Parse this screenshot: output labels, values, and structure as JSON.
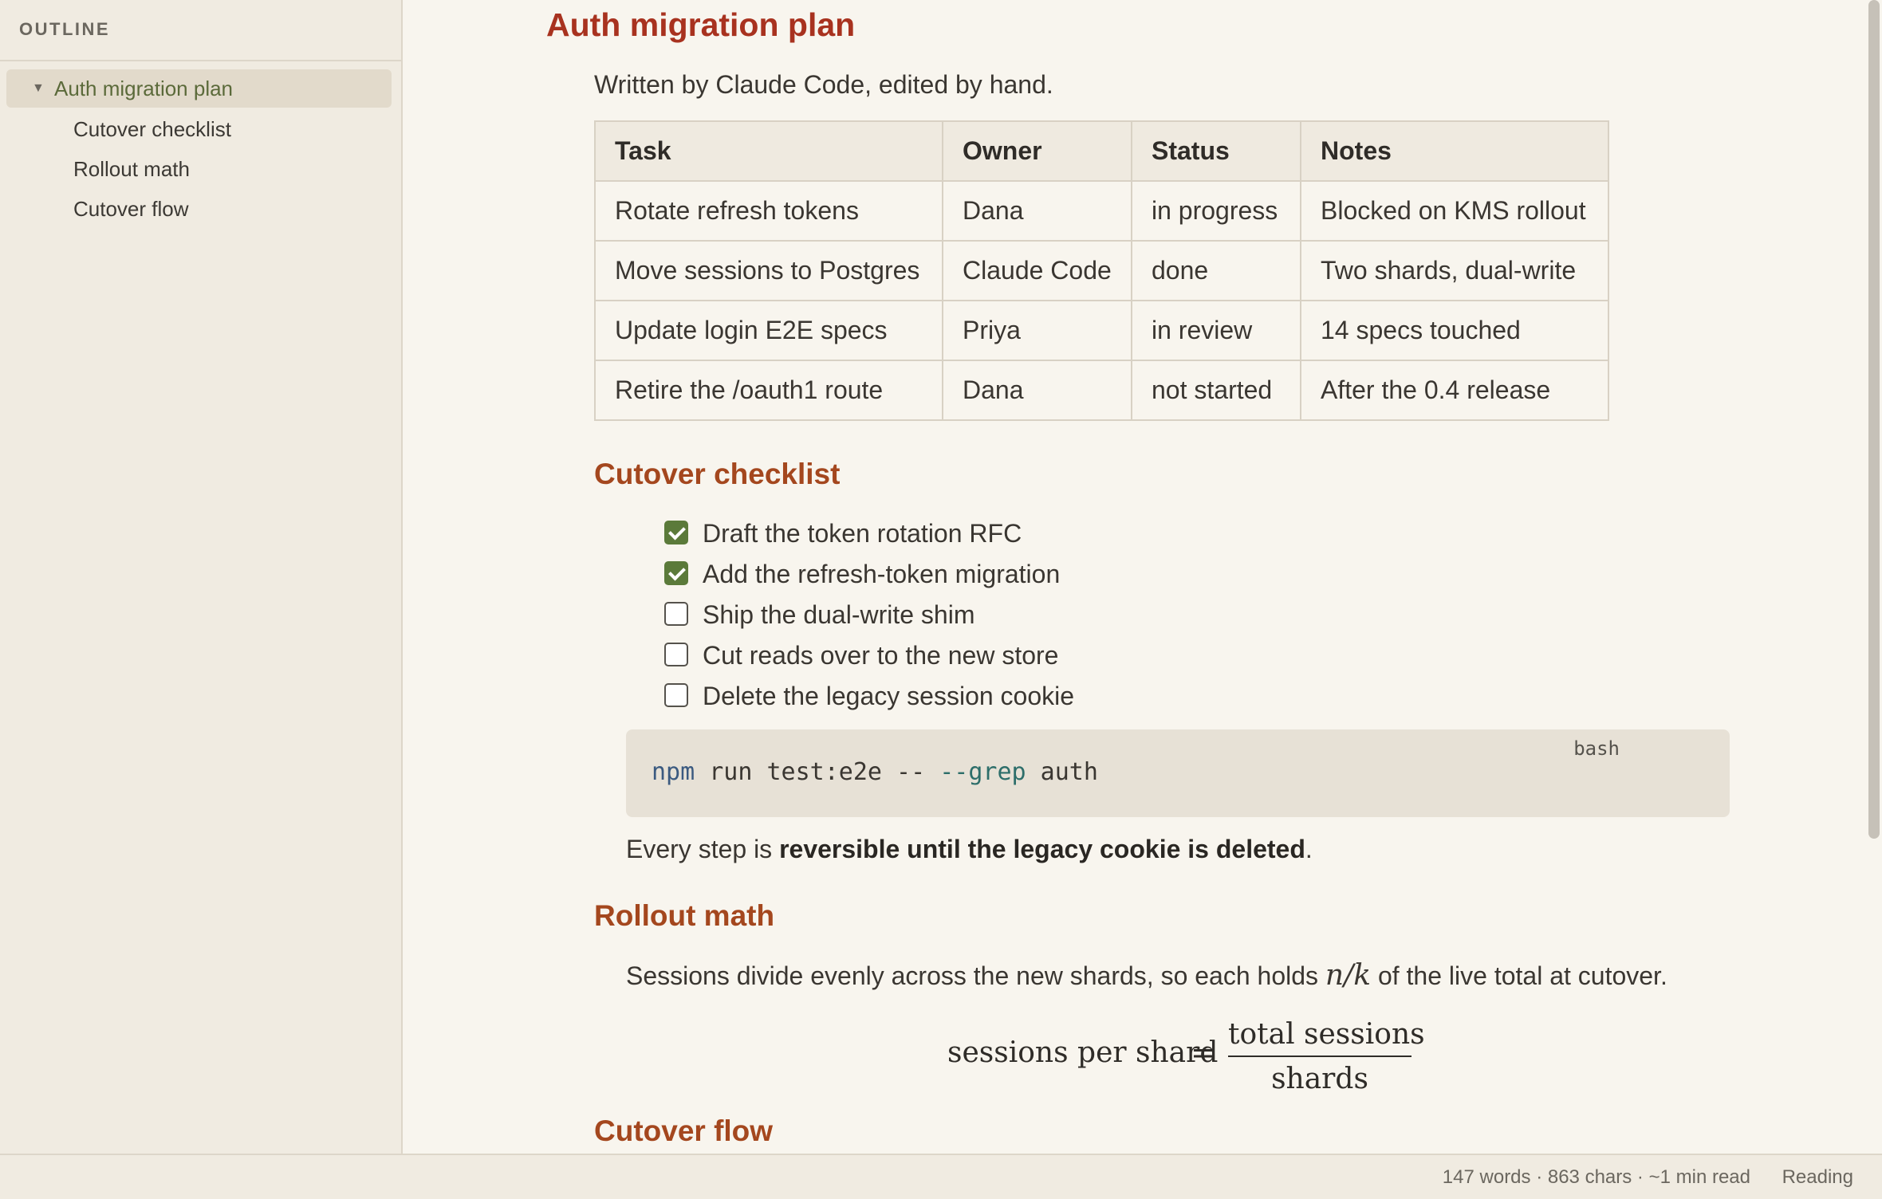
{
  "sidebar": {
    "title": "OUTLINE",
    "items": [
      {
        "label": "Auth migration plan",
        "level": 0,
        "active": true,
        "expanded": true
      },
      {
        "label": "Cutover checklist",
        "level": 1
      },
      {
        "label": "Rollout math",
        "level": 1
      },
      {
        "label": "Cutover flow",
        "level": 1
      }
    ]
  },
  "doc": {
    "title": "Auth migration plan",
    "subtitle": "Written by Claude Code, edited by hand.",
    "table": {
      "headers": [
        "Task",
        "Owner",
        "Status",
        "Notes"
      ],
      "rows": [
        [
          "Rotate refresh tokens",
          "Dana",
          "in progress",
          "Blocked on KMS rollout"
        ],
        [
          "Move sessions to Postgres",
          "Claude Code",
          "done",
          "Two shards, dual-write"
        ],
        [
          "Update login E2E specs",
          "Priya",
          "in review",
          "14 specs touched"
        ],
        [
          "Retire the /oauth1 route",
          "Dana",
          "not started",
          "After the 0.4 release"
        ]
      ]
    },
    "checklist_heading": "Cutover checklist",
    "checklist": [
      {
        "label": "Draft the token rotation RFC",
        "checked": true
      },
      {
        "label": "Add the refresh-token migration",
        "checked": true
      },
      {
        "label": "Ship the dual-write shim",
        "checked": false
      },
      {
        "label": "Cut reads over to the new store",
        "checked": false
      },
      {
        "label": "Delete the legacy session cookie",
        "checked": false
      }
    ],
    "code": {
      "lang": "bash",
      "cmd": "npm",
      "args1": " run test:e2e -- ",
      "flag": "--grep",
      "args2": " auth"
    },
    "reversible_para": {
      "pre": "Every step is ",
      "bold": "reversible until the legacy cookie is deleted",
      "post": "."
    },
    "rollout_heading": "Rollout math",
    "rollout_para": {
      "pre": "Sessions divide evenly across the new shards, so each holds ",
      "math": "n/k",
      "post": " of the live total at cutover."
    },
    "equation": {
      "lhs": "sessions per shard",
      "eq": "=",
      "numerator": "total sessions",
      "denominator": "shards"
    },
    "flow_heading": "Cutover flow"
  },
  "statusbar": {
    "stats": "147 words · 863 chars · ~1 min read",
    "mode": "Reading"
  },
  "colors": {
    "title": "#a8321f",
    "heading": "#a4471e",
    "checked": "#5b7a3a",
    "accent_active": "#5b6a3a"
  }
}
